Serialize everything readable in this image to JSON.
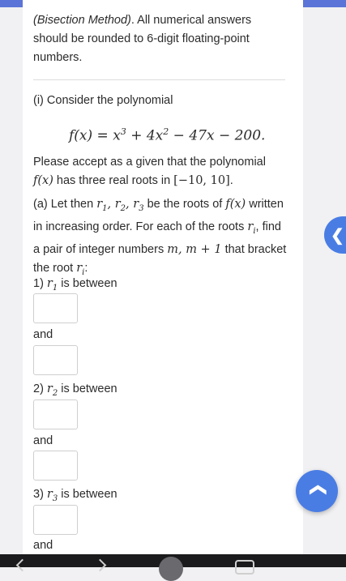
{
  "intro": {
    "method": "(Bisection Method)",
    "rest": ". All numerical answers should be rounded to 6-digit floating-point numbers."
  },
  "part_i": {
    "text": "(i) Consider the polynomial",
    "poly_lhs": "f(x)",
    "poly_rhs_a": "x",
    "exp3": "3",
    "poly_rhs_b": " + 4x",
    "exp2": "2",
    "poly_rhs_c": " − 47x − 200.",
    "accept_a": "Please accept as a given that the polynomial",
    "accept_fx": "f(x)",
    "accept_b": " has three real roots in ",
    "interval": "[−10, 10]",
    "accept_c": "."
  },
  "part_a": {
    "t1": "(a) Let then ",
    "roots": "r",
    "sub1": "1",
    "sub2": "2",
    "sub3": "3",
    "t2": " be the roots of ",
    "fx": "f(x)",
    "t3": " written in increasing order. For each of the roots ",
    "ri": "r",
    "subi": "i",
    "t4": ", find a pair of integer numbers ",
    "mm": "m, m + 1",
    "t5": " that bracket the root ",
    "t6": ":"
  },
  "questions": [
    {
      "num": "1) ",
      "sub": "1",
      "between": " is between",
      "and": "and"
    },
    {
      "num": "2) ",
      "sub": "2",
      "between": " is between",
      "and": "and"
    },
    {
      "num": "3) ",
      "sub": "3",
      "between": " is between",
      "and": "and"
    }
  ],
  "icons": {
    "side_tab": "chevron-left-icon",
    "scroll_top": "chevron-up-icon"
  },
  "colors": {
    "accent": "#4a7de4",
    "top_bar": "#5b74d8"
  }
}
